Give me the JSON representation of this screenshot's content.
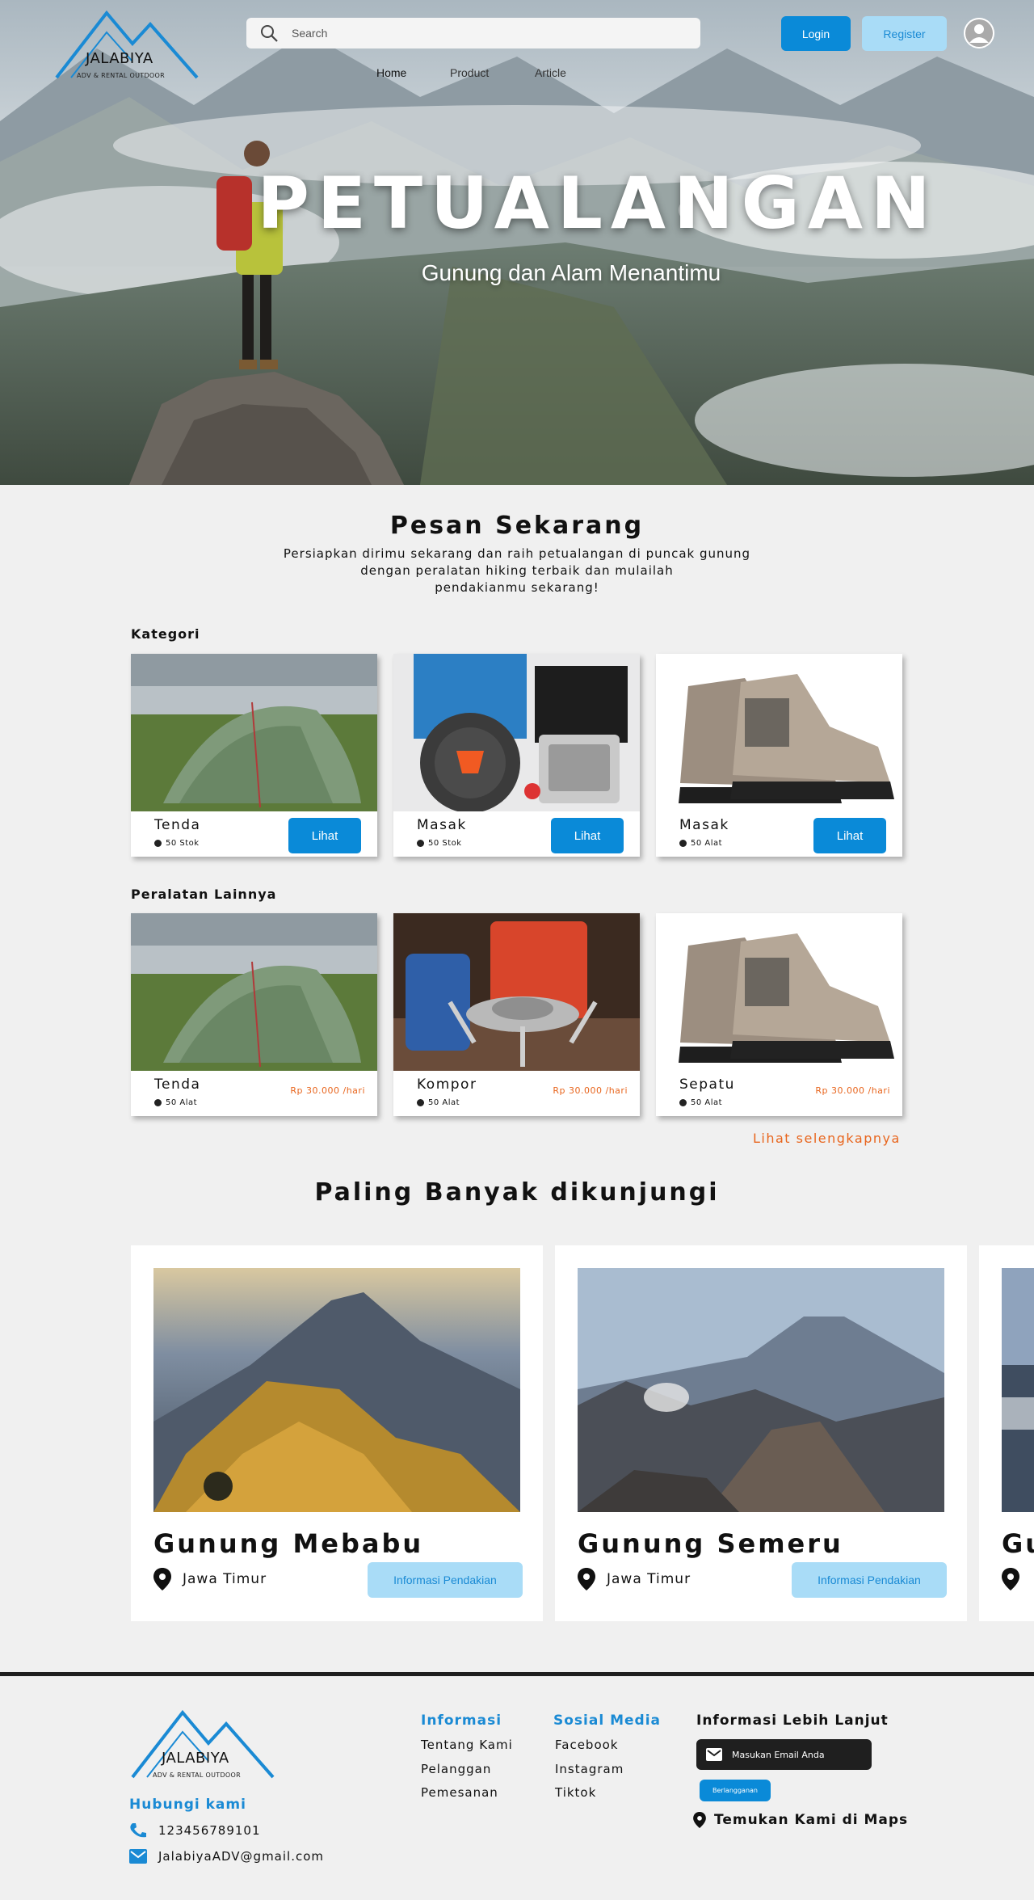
{
  "brand": {
    "name": "JALABIYA",
    "tagline": "ADV & RENTAL OUTDOOR"
  },
  "header": {
    "search_placeholder": "Search",
    "login_label": "Login",
    "register_label": "Register",
    "nav": [
      "Home",
      "Product",
      "Article"
    ]
  },
  "hero": {
    "title": "PETUALANGAN",
    "subtitle": "Gunung dan Alam Menantimu"
  },
  "order": {
    "title": "Pesan Sekarang",
    "desc_lines": [
      "Persiapkan dirimu sekarang dan raih petualangan di puncak gunung",
      "dengan peralatan hiking terbaik dan mulailah",
      "pendakianmu sekarang!"
    ]
  },
  "kategori": {
    "label": "Kategori",
    "items": [
      {
        "name": "Tenda",
        "stock": "50 Stok",
        "button": "Lihat"
      },
      {
        "name": "Masak",
        "stock": "50 Stok",
        "button": "Lihat"
      },
      {
        "name": "Masak",
        "stock": "50 Alat",
        "button": "Lihat"
      }
    ]
  },
  "peralatan": {
    "label": "Peralatan Lainnya",
    "items": [
      {
        "name": "Tenda",
        "stock": "50 Alat",
        "price": "Rp 30.000 /hari"
      },
      {
        "name": "Kompor",
        "stock": "50 Alat",
        "price": "Rp 30.000 /hari"
      },
      {
        "name": "Sepatu",
        "stock": "50 Alat",
        "price": "Rp 30.000 /hari"
      }
    ],
    "more_link": "Lihat selengkapnya"
  },
  "popular": {
    "title": "Paling Banyak dikunjungi",
    "items": [
      {
        "name": "Gunung Mebabu",
        "location": "Jawa Timur",
        "button": "Informasi Pendakian"
      },
      {
        "name": "Gunung Semeru",
        "location": "Jawa Timur",
        "button": "Informasi Pendakian"
      },
      {
        "name": "Gu"
      }
    ]
  },
  "footer": {
    "contact_title": "Hubungi kami",
    "phone": "123456789101",
    "email": "JalabiyaADV@gmail.com",
    "info_title": "Informasi",
    "info_links": [
      "Tentang Kami",
      "Pelanggan",
      "Pemesanan"
    ],
    "social_title": "Sosial Media",
    "social_links": [
      "Facebook",
      "Instagram",
      "Tiktok"
    ],
    "more_title": "Informasi Lebih Lanjut",
    "email_placeholder": "Masukan Email Anda",
    "subscribe_label": "Berlangganan",
    "maps_label": "Temukan Kami di Maps"
  },
  "colors": {
    "primary": "#0a8ad8",
    "light_primary": "#a9dcf7",
    "accent_orange": "#e8651d",
    "dark": "#1f1f1f",
    "background": "#f0f0f0"
  }
}
